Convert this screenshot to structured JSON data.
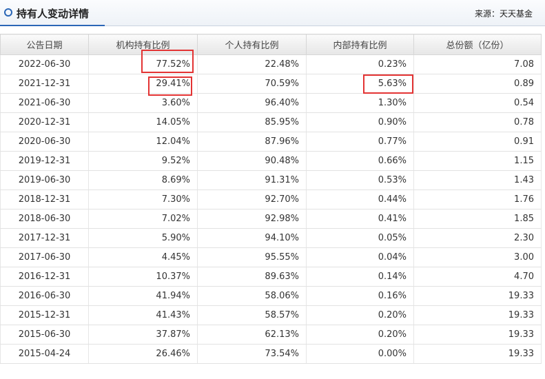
{
  "header": {
    "title": "持有人变动详情",
    "source": "来源：天天基金"
  },
  "table": {
    "columns": [
      "公告日期",
      "机构持有比例",
      "个人持有比例",
      "内部持有比例",
      "总份额（亿份）"
    ],
    "rows": [
      [
        "2022-06-30",
        "77.52%",
        "22.48%",
        "0.23%",
        "7.08"
      ],
      [
        "2021-12-31",
        "29.41%",
        "70.59%",
        "5.63%",
        "0.89"
      ],
      [
        "2021-06-30",
        "3.60%",
        "96.40%",
        "1.30%",
        "0.54"
      ],
      [
        "2020-12-31",
        "14.05%",
        "85.95%",
        "0.90%",
        "0.78"
      ],
      [
        "2020-06-30",
        "12.04%",
        "87.96%",
        "0.77%",
        "0.91"
      ],
      [
        "2019-12-31",
        "9.52%",
        "90.48%",
        "0.66%",
        "1.15"
      ],
      [
        "2019-06-30",
        "8.69%",
        "91.31%",
        "0.53%",
        "1.43"
      ],
      [
        "2018-12-31",
        "7.30%",
        "92.70%",
        "0.44%",
        "1.76"
      ],
      [
        "2018-06-30",
        "7.02%",
        "92.98%",
        "0.41%",
        "1.85"
      ],
      [
        "2017-12-31",
        "5.90%",
        "94.10%",
        "0.05%",
        "2.30"
      ],
      [
        "2017-06-30",
        "4.45%",
        "95.55%",
        "0.04%",
        "3.00"
      ],
      [
        "2016-12-31",
        "10.37%",
        "89.63%",
        "0.14%",
        "4.70"
      ],
      [
        "2016-06-30",
        "41.94%",
        "58.06%",
        "0.16%",
        "19.33"
      ],
      [
        "2015-12-31",
        "41.43%",
        "58.57%",
        "0.20%",
        "19.33"
      ],
      [
        "2015-06-30",
        "37.87%",
        "62.13%",
        "0.20%",
        "19.33"
      ],
      [
        "2015-04-24",
        "26.46%",
        "73.54%",
        "0.00%",
        "19.33"
      ]
    ]
  },
  "highlight_color": "#e33333"
}
